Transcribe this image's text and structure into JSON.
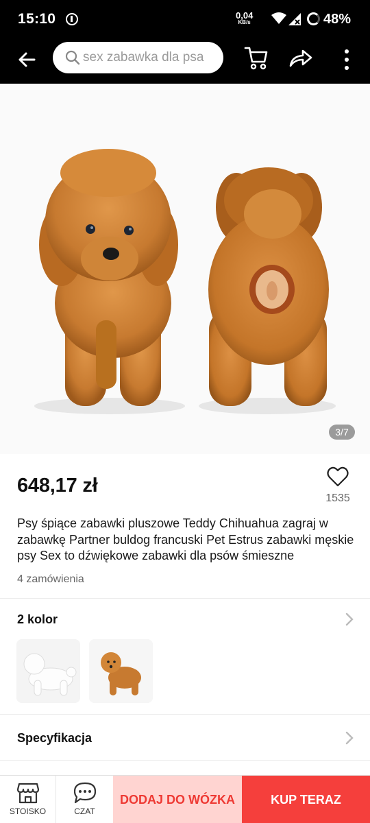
{
  "status_bar": {
    "time": "15:10",
    "speed_value": "0,04",
    "speed_unit": "KB/s",
    "battery": "48%"
  },
  "header": {
    "search_placeholder": "sex zabawka dla psa",
    "icons": [
      "back-arrow-icon",
      "search-icon",
      "cart-icon",
      "share-icon",
      "more-vertical-icon"
    ]
  },
  "gallery": {
    "counter": "3/7"
  },
  "product": {
    "price": "648,17 zł",
    "favorites": "1535",
    "title": "Psy śpiące zabawki pluszowe Teddy Chihuahua zagraj w zabawkę Partner buldog francuski Pet Estrus zabawki męskie psy Sex to dźwiękowe zabawki dla psów śmieszne",
    "orders": "4 zamówienia"
  },
  "variants": {
    "label": "2 kolor",
    "options": [
      "white-plush-dog",
      "brown-plush-dog"
    ]
  },
  "specs": {
    "label": "Specyfikacja"
  },
  "bottom_bar": {
    "store_label": "STOISKO",
    "chat_label": "CZAT",
    "add_to_cart": "DODAJ DO WÓZKA",
    "buy_now": "KUP TERAZ"
  },
  "colors": {
    "header_bg": "#000000",
    "accent_red": "#f53f3c",
    "accent_pink": "#ffd4d1",
    "plush_brown": "#c8782e"
  }
}
